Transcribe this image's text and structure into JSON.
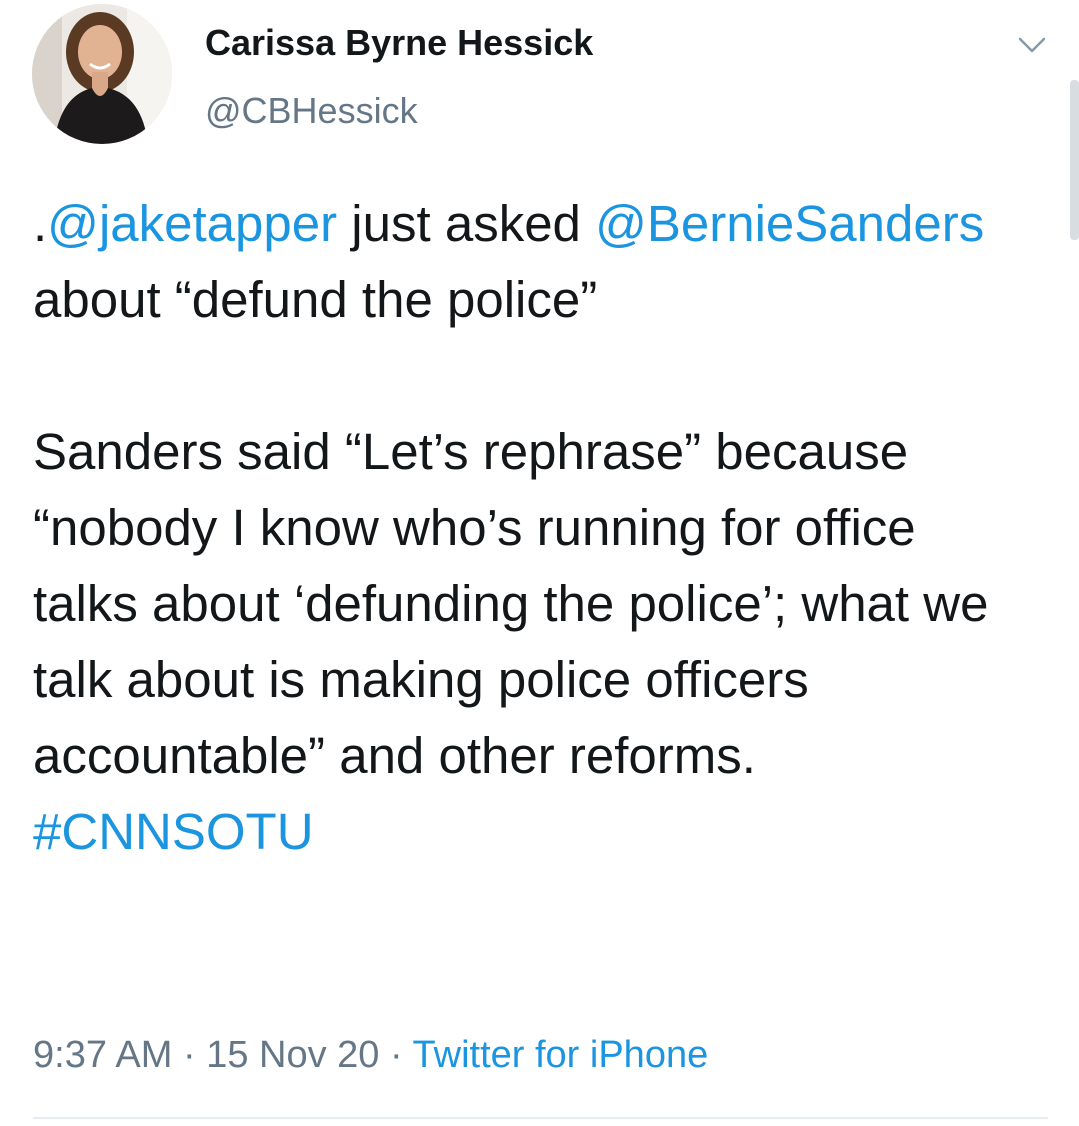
{
  "tweet": {
    "author": {
      "name": "Carissa Byrne Hessick",
      "handle": "@CBHessick"
    },
    "body": {
      "p1": {
        "mention1": "@jaketapper",
        "lead": ".",
        "t1": " just asked ",
        "mention2": "@BernieSanders",
        "t2": " about “defund the police”"
      },
      "p2": {
        "text": "Sanders said “Let’s rephrase” because “nobody I know who’s running for office talks about ‘defunding the police’; what we talk about is making police officers accountable” and other reforms. ",
        "hashtag": "#CNNSOTU"
      }
    },
    "meta": {
      "time": "9:37 AM",
      "sep1": " · ",
      "date": "15 Nov 20",
      "sep2": " · ",
      "source": "Twitter for iPhone"
    }
  },
  "icons": {
    "chevron": "chevron-down-icon",
    "avatar": "profile-photo"
  },
  "colors": {
    "link": "#1b95e0",
    "secondary_text": "#657786",
    "primary_text": "#14171a",
    "divider": "#e6ecf0"
  }
}
